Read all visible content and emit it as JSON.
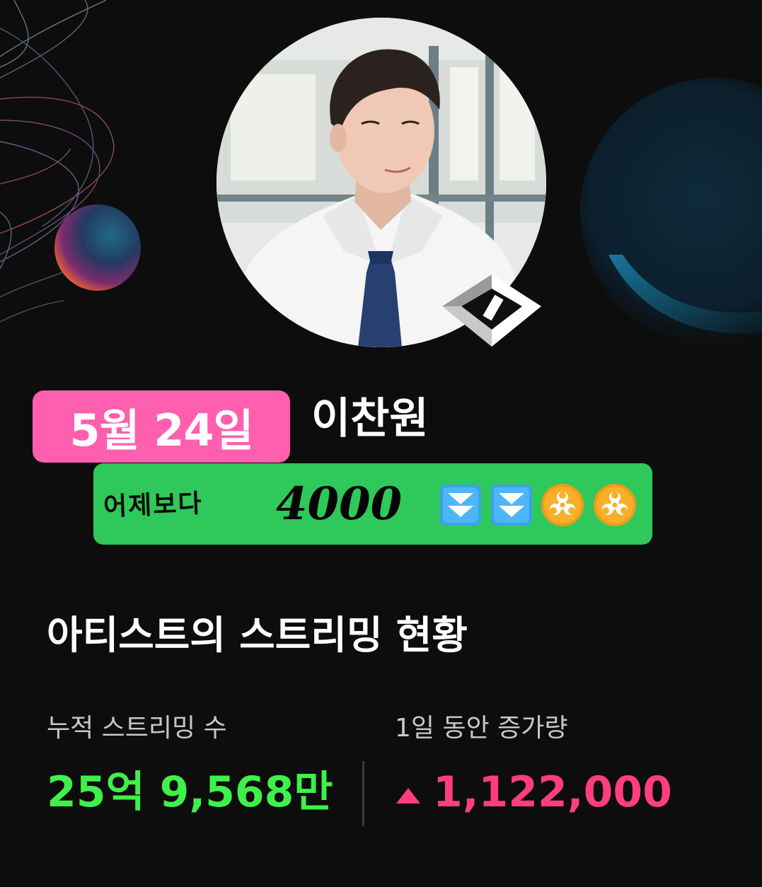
{
  "header": {
    "profile_image": "artist-profile-photo"
  },
  "date_badge": {
    "text": "5월 24일",
    "color": "#ff5fae"
  },
  "artist": {
    "name": "이찬원"
  },
  "comparison": {
    "label": "어제보다",
    "value": "4000",
    "icons": [
      "double-down-arrow-icon",
      "double-down-arrow-icon",
      "biohazard-icon",
      "biohazard-icon"
    ],
    "bg_color": "#2ec95a"
  },
  "section": {
    "title": "아티스트의 스트리밍 현황"
  },
  "stats": {
    "cumulative": {
      "label": "누적 스트리밍 수",
      "value": "25억 9,568만",
      "color": "#3ff04a"
    },
    "daily_increase": {
      "label": "1일 동안 증가량",
      "value": "1,122,000",
      "icon": "up-triangle-icon",
      "color": "#ff3d7f"
    }
  }
}
